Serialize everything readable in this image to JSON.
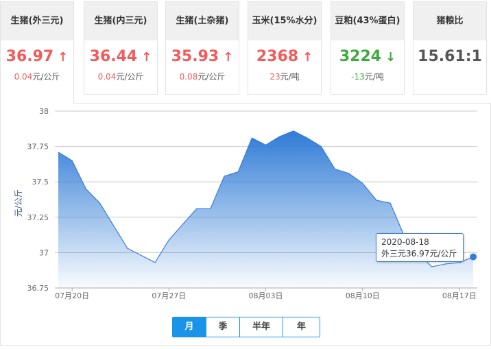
{
  "cards": [
    {
      "title": "生猪(外三元)",
      "value": "36.97",
      "arrow": "↑",
      "change_num": "0.04",
      "change_unit": "元/公斤",
      "trend": "up"
    },
    {
      "title": "生猪(内三元)",
      "value": "36.44",
      "arrow": "↑",
      "change_num": "0.04",
      "change_unit": "元/公斤",
      "trend": "up"
    },
    {
      "title": "生猪(土杂猪)",
      "value": "35.93",
      "arrow": "↑",
      "change_num": "0.08",
      "change_unit": "元/公斤",
      "trend": "up"
    },
    {
      "title": "玉米(15%水分)",
      "value": "2368",
      "arrow": "↑",
      "change_num": "23",
      "change_unit": "元/吨",
      "trend": "up"
    },
    {
      "title": "豆粕(43%蛋白)",
      "value": "3224",
      "arrow": "↓",
      "change_num": "-13",
      "change_unit": "元/吨",
      "trend": "down"
    },
    {
      "title": "猪粮比",
      "value": "15.61:1",
      "arrow": "",
      "change_num": "",
      "change_unit": "",
      "trend": "neu"
    }
  ],
  "colors": {
    "up": "#f45a5a",
    "down": "#3daa3d",
    "line": "#3a7bd5",
    "accent": "#1a94e8"
  },
  "tooltip": {
    "date": "2020-08-18",
    "text": "外三元36.97元/公斤"
  },
  "periods": [
    "月",
    "季",
    "半年",
    "年"
  ],
  "chart_data": {
    "type": "area",
    "ylabel": "元/公斤",
    "ylim": [
      36.75,
      38
    ],
    "yticks": [
      "36.75",
      "37",
      "37.25",
      "37.5",
      "37.75",
      "38"
    ],
    "xtick_labels": [
      "07月20日",
      "07月27日",
      "08月03日",
      "08月10日",
      "08月17日"
    ],
    "xtick_index": [
      1,
      8,
      15,
      22,
      29
    ],
    "x": [
      "07-19",
      "07-20",
      "07-21",
      "07-22",
      "07-23",
      "07-24",
      "07-25",
      "07-26",
      "07-27",
      "07-28",
      "07-29",
      "07-30",
      "07-31",
      "08-01",
      "08-02",
      "08-03",
      "08-04",
      "08-05",
      "08-06",
      "08-07",
      "08-08",
      "08-09",
      "08-10",
      "08-11",
      "08-12",
      "08-13",
      "08-14",
      "08-15",
      "08-16",
      "08-17",
      "08-18"
    ],
    "series": [
      {
        "name": "外三元",
        "values": [
          37.71,
          37.65,
          37.45,
          37.35,
          37.19,
          37.03,
          36.98,
          36.93,
          37.09,
          37.2,
          37.31,
          37.31,
          37.54,
          37.57,
          37.81,
          37.76,
          37.82,
          37.86,
          37.81,
          37.75,
          37.59,
          37.56,
          37.49,
          37.37,
          37.35,
          37.12,
          37.0,
          36.9,
          36.92,
          36.93,
          36.97
        ]
      }
    ],
    "grid": true
  }
}
